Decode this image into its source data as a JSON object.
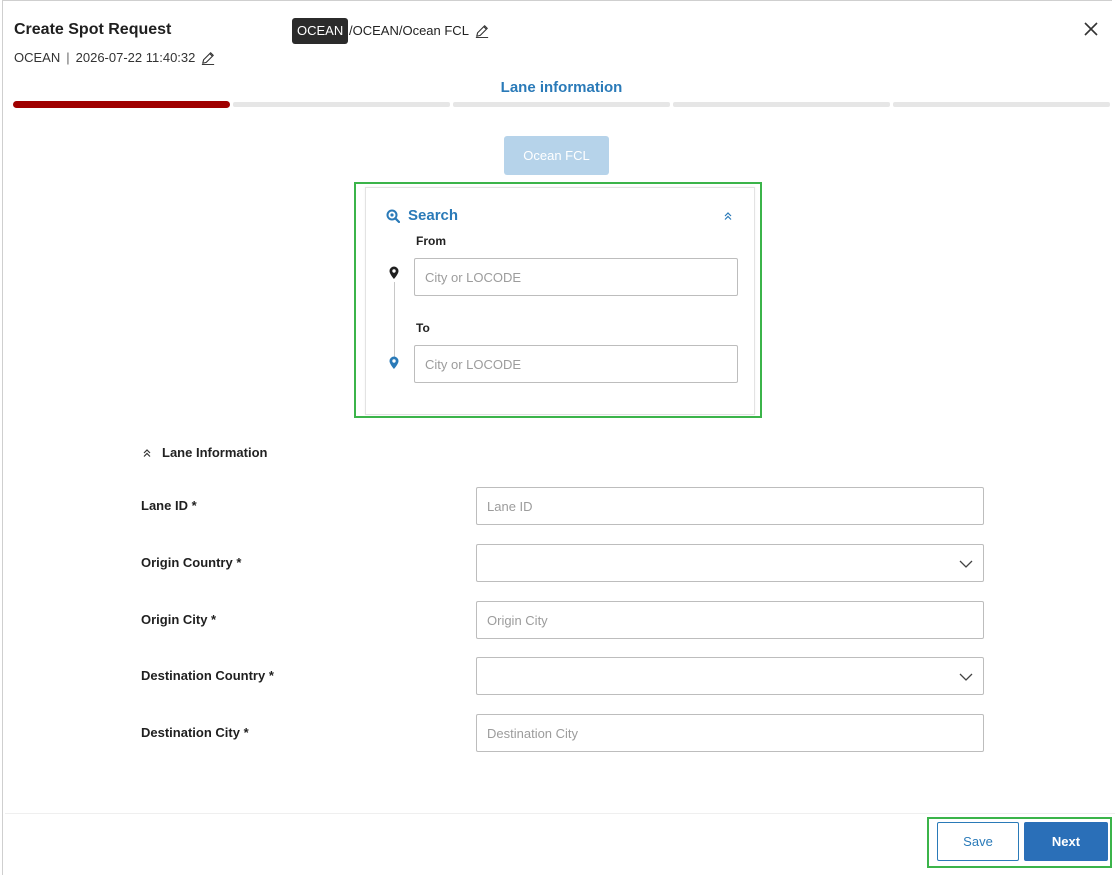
{
  "header": {
    "title": "Create Spot Request",
    "mode": "OCEAN",
    "separator": "|",
    "timestamp": "2026-07-22 11:40:32",
    "mode_badge": "OCEAN",
    "mode_path": "/OCEAN/Ocean FCL"
  },
  "stepper": {
    "current_step_title": "Lane information",
    "total_steps": 5,
    "active_step": 1,
    "accent_color": "#a00000"
  },
  "mode_chip": {
    "label": "Ocean FCL"
  },
  "search": {
    "title": "Search",
    "from_label": "From",
    "from_placeholder": "City or LOCODE",
    "to_label": "To",
    "to_placeholder": "City or LOCODE"
  },
  "lane_section": {
    "title": "Lane Information",
    "fields": {
      "lane_id": {
        "label": "Lane ID *",
        "placeholder": "Lane ID"
      },
      "origin_country": {
        "label": "Origin Country *",
        "value": ""
      },
      "origin_city": {
        "label": "Origin City *",
        "placeholder": "Origin City"
      },
      "destination_country": {
        "label": "Destination Country *",
        "value": ""
      },
      "destination_city": {
        "label": "Destination City *",
        "placeholder": "Destination City"
      }
    }
  },
  "footer": {
    "save_label": "Save",
    "next_label": "Next"
  },
  "colors": {
    "primary": "#2a7ab8",
    "highlight": "#3bb44a",
    "chip": "#b6d3ea"
  }
}
